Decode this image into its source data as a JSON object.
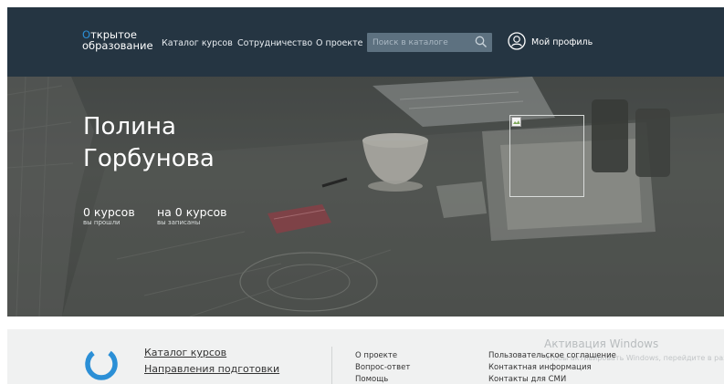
{
  "header": {
    "logo": {
      "first_letter": "О",
      "line1_rest": "ткрытое",
      "line2": "образование"
    },
    "nav": [
      "Каталог курсов",
      "Сотрудничество",
      "О проекте"
    ],
    "search": {
      "placeholder": "Поиск в каталоге"
    },
    "profile_label": "Мой профиль"
  },
  "hero": {
    "name_first": "Полина",
    "name_last": "Горбунова",
    "stats": [
      {
        "value": "0 курсов",
        "caption": "вы прошли"
      },
      {
        "value": "на 0 курсов",
        "caption": "вы записаны"
      }
    ]
  },
  "footer": {
    "primary_links": [
      "Каталог курсов",
      "Направления подготовки"
    ],
    "col2": [
      "О проекте",
      "Вопрос-ответ",
      "Помощь"
    ],
    "col3": [
      "Пользовательское соглашение",
      "Контактная информация",
      "Контакты для СМИ"
    ]
  },
  "watermark": {
    "title": "Активация Windows",
    "text": "Чтобы активировать Windows, перейдите в раздел \"Параметры\"."
  },
  "colors": {
    "header_bg": "#253542",
    "accent": "#2b8fd6",
    "footer_bg": "#f0f1f1"
  },
  "icons": [
    "search-icon",
    "user-icon",
    "broken-image-icon",
    "logo-ring-icon"
  ]
}
